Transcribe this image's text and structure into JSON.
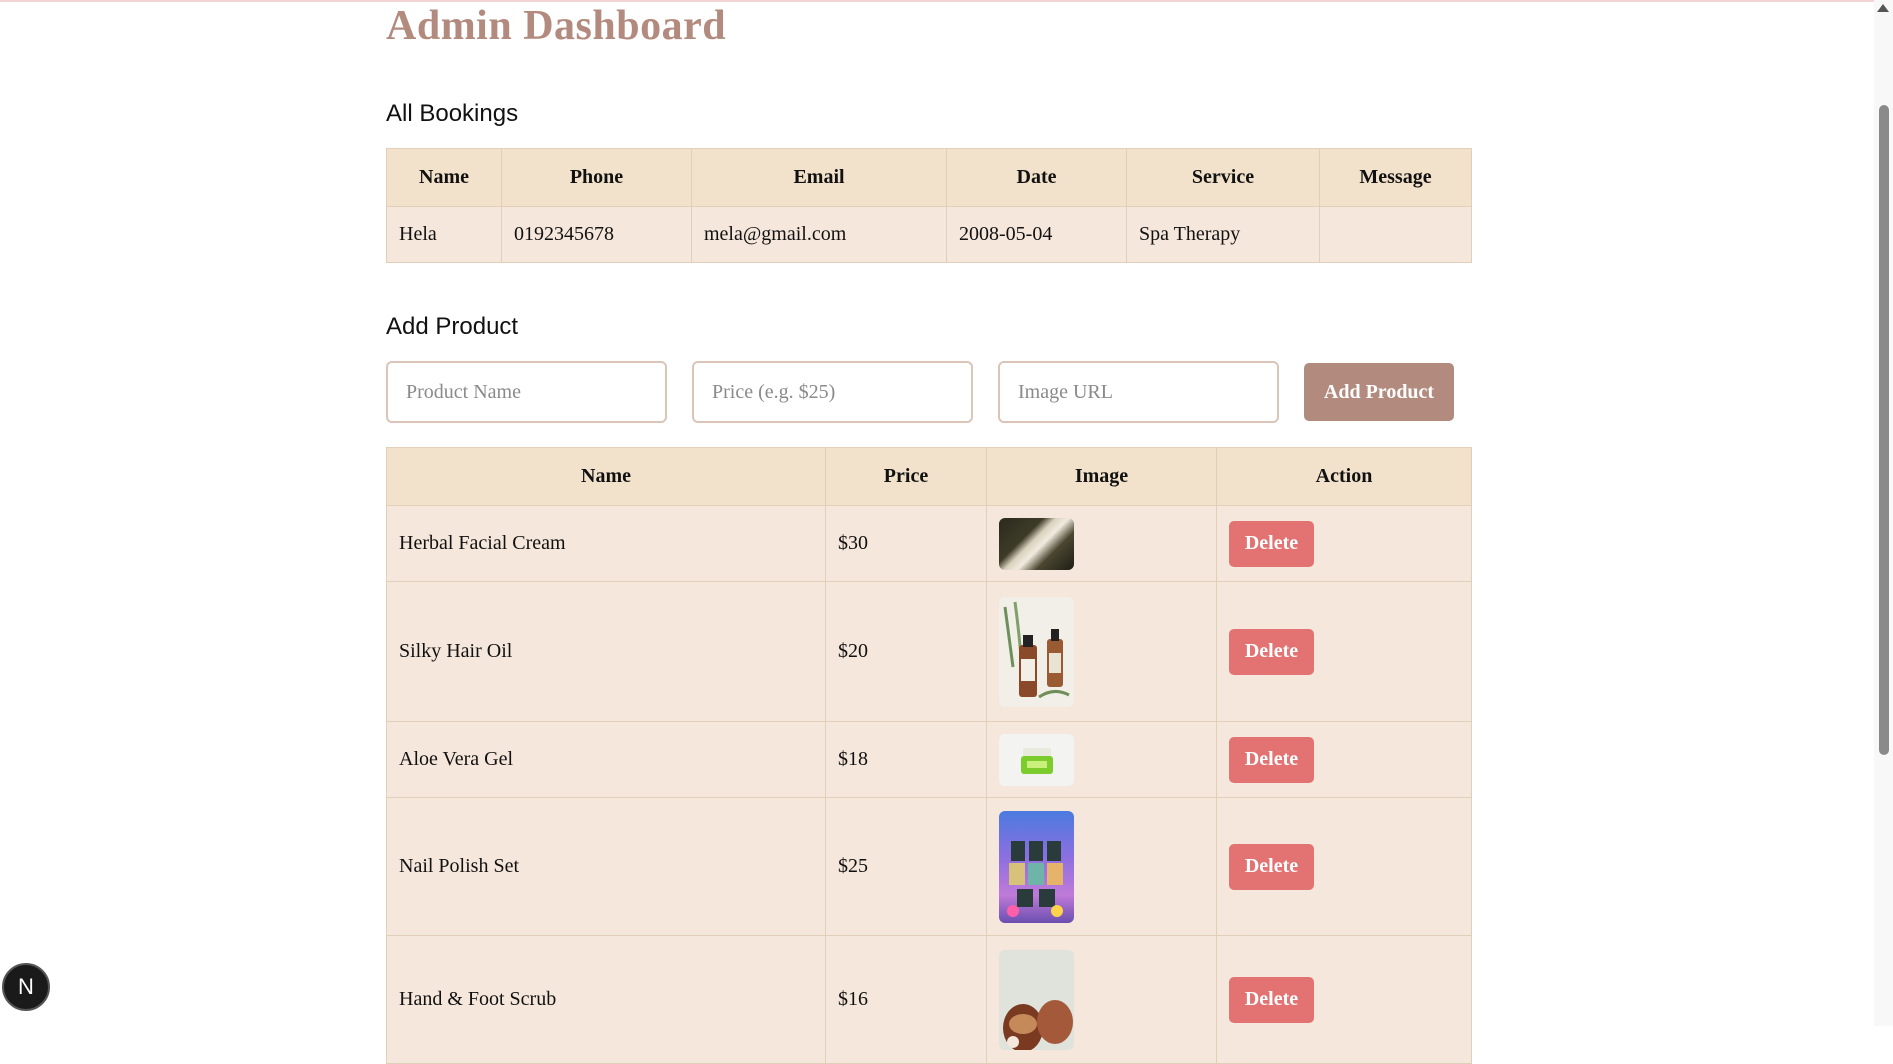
{
  "header": {
    "title": "Admin Dashboard"
  },
  "bookings": {
    "section_title": "All Bookings",
    "columns": [
      "Name",
      "Phone",
      "Email",
      "Date",
      "Service",
      "Message"
    ],
    "rows": [
      {
        "name": "Hela",
        "phone": "0192345678",
        "email": "mela@gmail.com",
        "date": "2008-05-04",
        "service": "Spa Therapy",
        "message": ""
      }
    ]
  },
  "add_product": {
    "section_title": "Add Product",
    "name_placeholder": "Product Name",
    "price_placeholder": "Price (e.g. $25)",
    "image_placeholder": "Image URL",
    "button_label": "Add Product"
  },
  "products": {
    "columns": [
      "Name",
      "Price",
      "Image",
      "Action"
    ],
    "delete_label": "Delete",
    "rows": [
      {
        "name": "Herbal Facial Cream",
        "price": "$30"
      },
      {
        "name": "Silky Hair Oil",
        "price": "$20"
      },
      {
        "name": "Aloe Vera Gel",
        "price": "$18"
      },
      {
        "name": "Nail Polish Set",
        "price": "$25"
      },
      {
        "name": "Hand & Foot Scrub",
        "price": "$16"
      }
    ]
  },
  "dev_badge": {
    "label": "N"
  },
  "colors": {
    "accent": "#b28a7e",
    "delete": "#e37373",
    "table_header": "#f3e2cb",
    "table_cell": "#f5e7db"
  }
}
